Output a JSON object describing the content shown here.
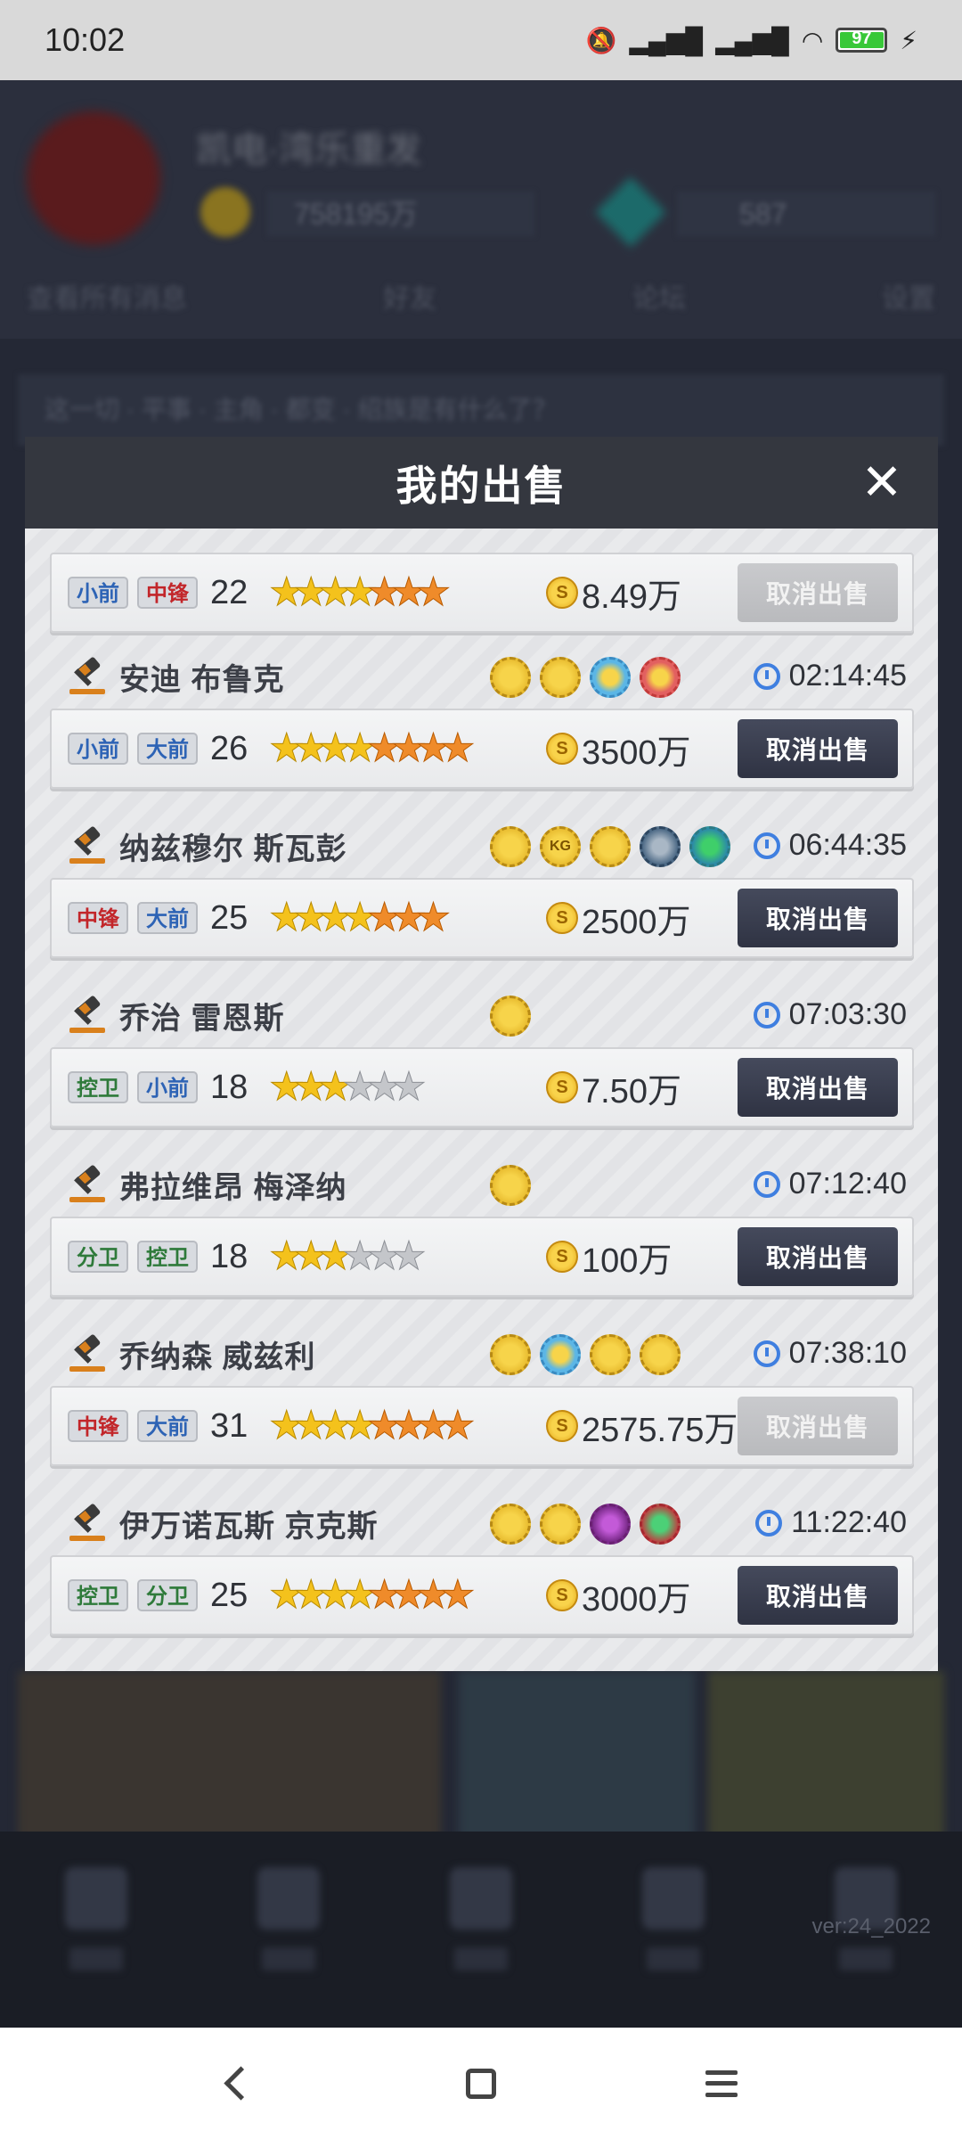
{
  "status_bar": {
    "time": "10:02",
    "battery": "97"
  },
  "background": {
    "team_name": "凯电·湾乐重发",
    "coins": "758195万",
    "gems": "587",
    "menu": [
      "查看所有消息",
      "好友",
      "论坛",
      "设置"
    ],
    "notice": "这一切 · 平事 · 主角 · 都变 · 绍族是有什么了？",
    "version": "ver:24_2022"
  },
  "modal": {
    "title": "我的出售",
    "close_label": "✕",
    "cancel_label": "取消出售",
    "first_card": {
      "positions": [
        {
          "label": "小前",
          "color": "blue"
        },
        {
          "label": "中锋",
          "color": "red"
        }
      ],
      "rating": "22",
      "stars": {
        "gold": 4,
        "orange": 3,
        "grey": 0,
        "style": "broken"
      },
      "price": "8.49万",
      "button_state": "disabled"
    },
    "sales": [
      {
        "name": "安迪 布鲁克",
        "badges": [
          "gold",
          "gold",
          "blue",
          "red"
        ],
        "time": "02:14:45",
        "positions": [
          {
            "label": "小前",
            "color": "blue"
          },
          {
            "label": "大前",
            "color": "blue"
          }
        ],
        "rating": "26",
        "stars": {
          "gold": 4,
          "orange": 4,
          "grey": 0
        },
        "price": "3500万",
        "button_state": "active"
      },
      {
        "name": "纳兹穆尔 斯瓦彭",
        "badges": [
          "gold",
          "gold",
          "gold",
          "steel",
          "green"
        ],
        "time": "06:44:35",
        "positions": [
          {
            "label": "中锋",
            "color": "red"
          },
          {
            "label": "大前",
            "color": "blue"
          }
        ],
        "rating": "25",
        "stars": {
          "gold": 4,
          "orange": 3,
          "grey": 0
        },
        "price": "2500万",
        "button_state": "active"
      },
      {
        "name": "乔治 雷恩斯",
        "badges": [
          "gold"
        ],
        "time": "07:03:30",
        "positions": [
          {
            "label": "控卫",
            "color": "green"
          },
          {
            "label": "小前",
            "color": "blue"
          }
        ],
        "rating": "18",
        "stars": {
          "gold": 3,
          "orange": 0,
          "grey": 3
        },
        "price": "7.50万",
        "button_state": "active"
      },
      {
        "name": "弗拉维昂 梅泽纳",
        "badges": [
          "gold"
        ],
        "time": "07:12:40",
        "positions": [
          {
            "label": "分卫",
            "color": "green"
          },
          {
            "label": "控卫",
            "color": "green"
          }
        ],
        "rating": "18",
        "stars": {
          "gold": 3,
          "orange": 0,
          "grey": 3
        },
        "price": "100万",
        "button_state": "active"
      },
      {
        "name": "乔纳森 威兹利",
        "badges": [
          "gold",
          "blue",
          "gold",
          "gold"
        ],
        "time": "07:38:10",
        "positions": [
          {
            "label": "中锋",
            "color": "red"
          },
          {
            "label": "大前",
            "color": "blue"
          }
        ],
        "rating": "31",
        "stars": {
          "gold": 4,
          "orange": 4,
          "grey": 0
        },
        "price": "2575.75万",
        "button_state": "disabled"
      },
      {
        "name": "伊万诺瓦斯 京克斯",
        "badges": [
          "gold",
          "gold",
          "purple",
          "emerald"
        ],
        "time": "11:22:40",
        "positions": [
          {
            "label": "控卫",
            "color": "green"
          },
          {
            "label": "分卫",
            "color": "green"
          }
        ],
        "rating": "25",
        "stars": {
          "gold": 4,
          "orange": 4,
          "grey": 0
        },
        "price": "3000万",
        "button_state": "active"
      }
    ]
  }
}
